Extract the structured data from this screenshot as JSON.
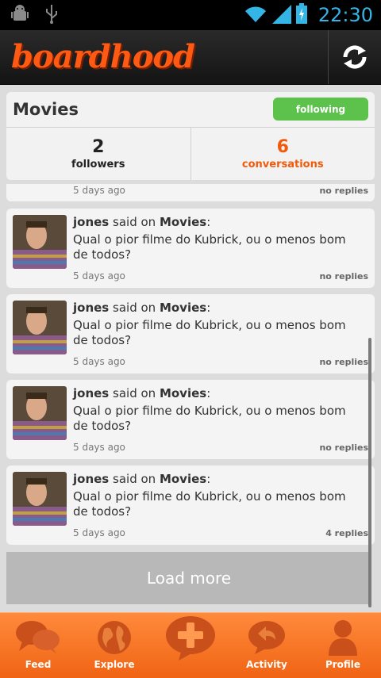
{
  "status_bar": {
    "time": "22:30"
  },
  "app": {
    "logo_text": "boardhood"
  },
  "board": {
    "title": "Movies",
    "follow_label": "following",
    "followers_count": "2",
    "followers_label": "followers",
    "conversations_count": "6",
    "conversations_label": "conversations"
  },
  "partial_item": {
    "time": "5 days ago",
    "replies": "no replies"
  },
  "conversations": [
    {
      "user": "jones",
      "said_on": "said on",
      "board": "Movies",
      "colon": ":",
      "message": "Qual o pior filme do Kubrick, ou o menos bom de todos?",
      "time": "5 days ago",
      "replies": "no replies"
    },
    {
      "user": "jones",
      "said_on": "said on",
      "board": "Movies",
      "colon": ":",
      "message": "Qual o pior filme do Kubrick, ou o menos bom de todos?",
      "time": "5 days ago",
      "replies": "no replies"
    },
    {
      "user": "jones",
      "said_on": "said on",
      "board": "Movies",
      "colon": ":",
      "message": "Qual o pior filme do Kubrick, ou o menos bom de todos?",
      "time": "5 days ago",
      "replies": "no replies"
    },
    {
      "user": "jones",
      "said_on": "said on",
      "board": "Movies",
      "colon": ":",
      "message": "Qual o pior filme do Kubrick, ou o menos bom de todos?",
      "time": "5 days ago",
      "replies": "4 replies"
    }
  ],
  "load_more_label": "Load more",
  "nav": [
    {
      "label": "Feed",
      "icon": "feed-icon"
    },
    {
      "label": "Explore",
      "icon": "globe-icon"
    },
    {
      "label": "",
      "icon": "plus-icon"
    },
    {
      "label": "Activity",
      "icon": "activity-icon"
    },
    {
      "label": "Profile",
      "icon": "profile-icon"
    }
  ],
  "colors": {
    "accent": "#f05a0a",
    "follow": "#5cc24c",
    "status_time": "#33b5e5"
  }
}
